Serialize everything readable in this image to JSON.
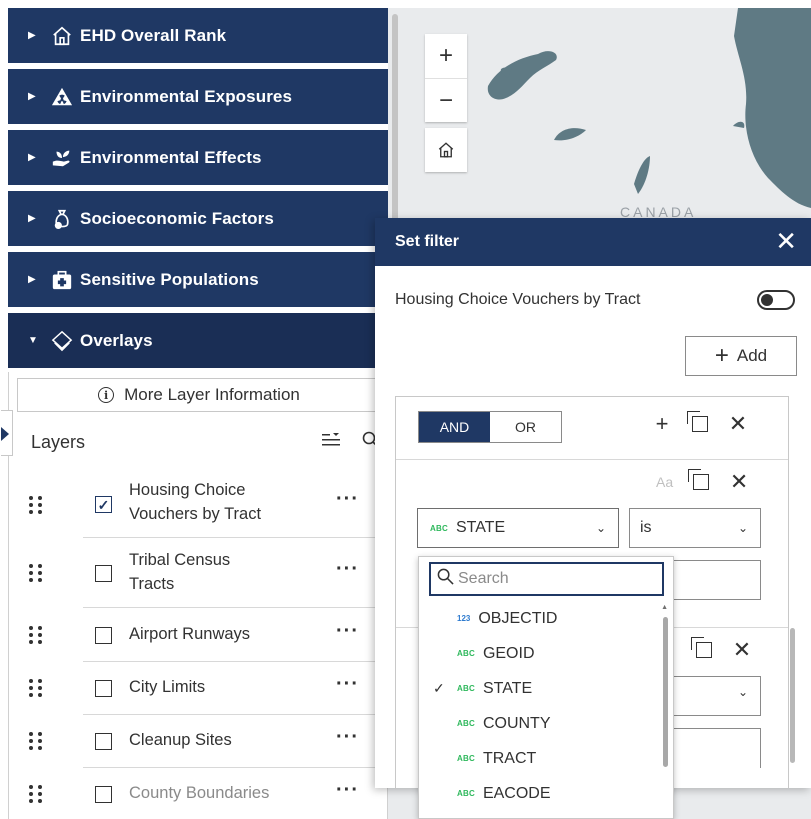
{
  "accordion": [
    {
      "label": "EHD Overall Rank",
      "icon": "house-icon",
      "state": "collapsed"
    },
    {
      "label": "Environmental Exposures",
      "icon": "hazard-icon",
      "state": "collapsed"
    },
    {
      "label": "Environmental Effects",
      "icon": "plant-hand-icon",
      "state": "collapsed"
    },
    {
      "label": "Socioeconomic Factors",
      "icon": "money-bag-icon",
      "state": "collapsed"
    },
    {
      "label": "Sensitive Populations",
      "icon": "medical-kit-icon",
      "state": "collapsed"
    },
    {
      "label": "Overlays",
      "icon": "layers-icon",
      "state": "expanded"
    }
  ],
  "layers_panel": {
    "more_info_label": "More Layer Information",
    "title": "Layers",
    "layers": [
      {
        "name": "Housing Choice Vouchers by Tract",
        "checked": true
      },
      {
        "name": "Tribal Census Tracts",
        "checked": false
      },
      {
        "name": "Airport Runways",
        "checked": false
      },
      {
        "name": "City Limits",
        "checked": false
      },
      {
        "name": "Cleanup Sites",
        "checked": false
      },
      {
        "name": "County Boundaries",
        "checked": false
      }
    ],
    "more_label": "···"
  },
  "map": {
    "zoom_in": "+",
    "zoom_out": "−",
    "country_label": "CANADA"
  },
  "filter": {
    "title": "Set filter",
    "layer_name": "Housing Choice Vouchers by Tract",
    "toggle_on": false,
    "add_label": "Add",
    "and_label": "AND",
    "or_label": "OR",
    "logic_selected": "AND",
    "case_label": "Aa",
    "field_type": "ABC",
    "field_selected": "STATE",
    "operator": "is",
    "search_placeholder": "Search",
    "fields": [
      {
        "type": "123",
        "name": "OBJECTID",
        "selected": false
      },
      {
        "type": "ABC",
        "name": "GEOID",
        "selected": false
      },
      {
        "type": "ABC",
        "name": "STATE",
        "selected": true
      },
      {
        "type": "ABC",
        "name": "COUNTY",
        "selected": false
      },
      {
        "type": "ABC",
        "name": "TRACT",
        "selected": false
      },
      {
        "type": "ABC",
        "name": "EACODE",
        "selected": false
      }
    ]
  },
  "colors": {
    "accent": "#1f3864",
    "abc_type": "#2eb85c",
    "number_type": "#2e7bcf",
    "map_land": "#5f7a84",
    "map_bg": "#e9ebed"
  }
}
